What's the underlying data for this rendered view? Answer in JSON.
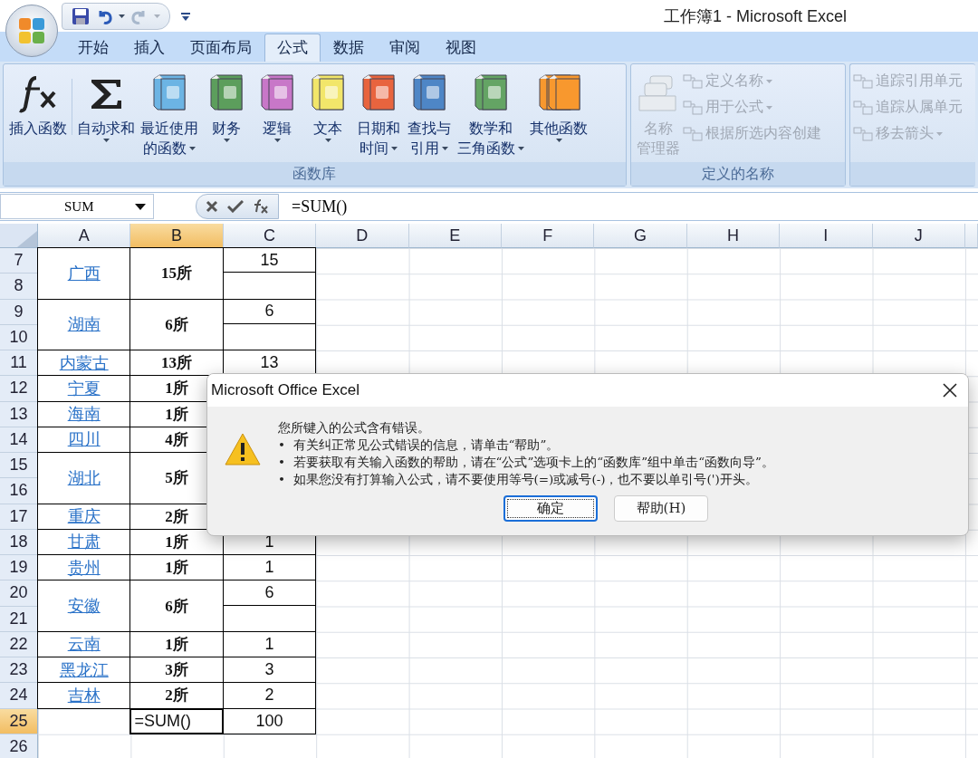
{
  "window": {
    "title": "工作簿1 - Microsoft Excel"
  },
  "tabs": [
    {
      "label": "开始",
      "selected": false
    },
    {
      "label": "插入",
      "selected": false
    },
    {
      "label": "页面布局",
      "selected": false
    },
    {
      "label": "公式",
      "selected": true
    },
    {
      "label": "数据",
      "selected": false
    },
    {
      "label": "审阅",
      "selected": false
    },
    {
      "label": "视图",
      "selected": false
    }
  ],
  "ribbon": {
    "groups": [
      {
        "kind": "functions",
        "label": "函数库",
        "buttons": [
          {
            "kind": "fx",
            "lines": [
              "插入函数"
            ],
            "caret": false
          },
          {
            "kind": "sigma",
            "lines": [
              "自动求和"
            ],
            "caret": true
          },
          {
            "kind": "book",
            "color": "#6cb4e4",
            "lines": [
              "最近使用",
              "的函数"
            ],
            "caret": true
          },
          {
            "kind": "book",
            "color": "#5c9e5c",
            "lines": [
              "财务"
            ],
            "caret": true
          },
          {
            "kind": "book",
            "color": "#c877c8",
            "lines": [
              "逻辑"
            ],
            "caret": true
          },
          {
            "kind": "book",
            "color": "#f2e66a",
            "lines": [
              "文本"
            ],
            "caret": true
          },
          {
            "kind": "book",
            "color": "#e8643e",
            "lines": [
              "日期和",
              "时间"
            ],
            "caret": true
          },
          {
            "kind": "book",
            "color": "#4e86c6",
            "lines": [
              "查找与",
              "引用"
            ],
            "caret": true
          },
          {
            "kind": "book",
            "color": "#64a464",
            "lines": [
              "数学和",
              "三角函数"
            ],
            "caret": true
          },
          {
            "kind": "books",
            "color": "#f8982e",
            "lines": [
              "其他函数"
            ],
            "caret": true
          }
        ]
      },
      {
        "kind": "names",
        "label": "定义的名称",
        "manager": {
          "lines": [
            "名称",
            "管理器"
          ],
          "disabled": true
        },
        "items": [
          {
            "label": "定义名称",
            "caret": true,
            "disabled": true
          },
          {
            "label": "用于公式",
            "caret": true,
            "disabled": true
          },
          {
            "label": "根据所选内容创建",
            "caret": false,
            "disabled": true
          }
        ]
      },
      {
        "kind": "audit",
        "items": [
          {
            "label": "追踪引用单元",
            "caret": false,
            "disabled": true
          },
          {
            "label": "追踪从属单元",
            "caret": false,
            "disabled": true
          },
          {
            "label": "移去箭头",
            "caret": true,
            "disabled": true
          }
        ]
      }
    ]
  },
  "formula_bar": {
    "name_box": "SUM",
    "formula": "=SUM()"
  },
  "sheet": {
    "columns": [
      {
        "label": "A",
        "selected": false
      },
      {
        "label": "B",
        "selected": true
      },
      {
        "label": "C",
        "selected": false
      },
      {
        "label": "D",
        "selected": false
      },
      {
        "label": "E",
        "selected": false
      },
      {
        "label": "F",
        "selected": false
      },
      {
        "label": "G",
        "selected": false
      },
      {
        "label": "H",
        "selected": false
      },
      {
        "label": "I",
        "selected": false
      },
      {
        "label": "J",
        "selected": false
      }
    ],
    "row_numbers": [
      {
        "label": "7",
        "selected": false
      },
      {
        "label": "8",
        "selected": false
      },
      {
        "label": "9",
        "selected": false
      },
      {
        "label": "10",
        "selected": false
      },
      {
        "label": "11",
        "selected": false
      },
      {
        "label": "12",
        "selected": false
      },
      {
        "label": "13",
        "selected": false
      },
      {
        "label": "14",
        "selected": false
      },
      {
        "label": "15",
        "selected": false
      },
      {
        "label": "16",
        "selected": false
      },
      {
        "label": "17",
        "selected": false
      },
      {
        "label": "18",
        "selected": false
      },
      {
        "label": "19",
        "selected": false
      },
      {
        "label": "20",
        "selected": false
      },
      {
        "label": "21",
        "selected": false
      },
      {
        "label": "22",
        "selected": false
      },
      {
        "label": "23",
        "selected": false
      },
      {
        "label": "24",
        "selected": false
      },
      {
        "label": "25",
        "selected": true
      },
      {
        "label": "26",
        "selected": false
      }
    ],
    "entries": [
      {
        "region": "广西",
        "count": "15所",
        "total": "15",
        "merged": true,
        "editing": false
      },
      {
        "region": "湖南",
        "count": "6所",
        "total": "6",
        "merged": true,
        "editing": false
      },
      {
        "region": "内蒙古",
        "count": "13所",
        "total": "13",
        "merged": false,
        "editing": false
      },
      {
        "region": "宁夏",
        "count": "1所",
        "merged": false,
        "editing": false
      },
      {
        "region": "海南",
        "count": "1所",
        "merged": false,
        "editing": false
      },
      {
        "region": "四川",
        "count": "4所",
        "merged": false,
        "editing": false
      },
      {
        "region": "湖北",
        "count": "5所",
        "merged": true,
        "editing": false
      },
      {
        "region": "重庆",
        "count": "2所",
        "merged": false,
        "editing": false
      },
      {
        "region": "甘肃",
        "count": "1所",
        "total": "1",
        "merged": false,
        "editing": false
      },
      {
        "region": "贵州",
        "count": "1所",
        "total": "1",
        "merged": false,
        "editing": false
      },
      {
        "region": "安徽",
        "count": "6所",
        "total": "6",
        "merged": true,
        "editing": false
      },
      {
        "region": "云南",
        "count": "1所",
        "total": "1",
        "merged": false,
        "editing": false
      },
      {
        "region": "黑龙江",
        "count": "3所",
        "total": "3",
        "merged": false,
        "editing": false
      },
      {
        "region": "吉林",
        "count": "2所",
        "total": "2",
        "merged": false,
        "editing": false
      },
      {
        "count": "=SUM()",
        "total": "100",
        "merged": false,
        "editing": true
      }
    ]
  },
  "dialog": {
    "title": "Microsoft Office Excel",
    "lines": [
      "您所键入的公式含有错误。",
      "•  有关纠正常见公式错误的信息，请单击“帮助”。",
      "•  若要获取有关输入函数的帮助，请在“公式”选项卡上的“函数库”组中单击“函数向导”。",
      "•  如果您没有打算输入公式，请不要使用等号(=)或减号(-)，也不要以单引号(')开头。"
    ],
    "buttons": [
      {
        "label": "确定",
        "default": true
      },
      {
        "label": "帮助(H)",
        "default": false
      }
    ]
  }
}
